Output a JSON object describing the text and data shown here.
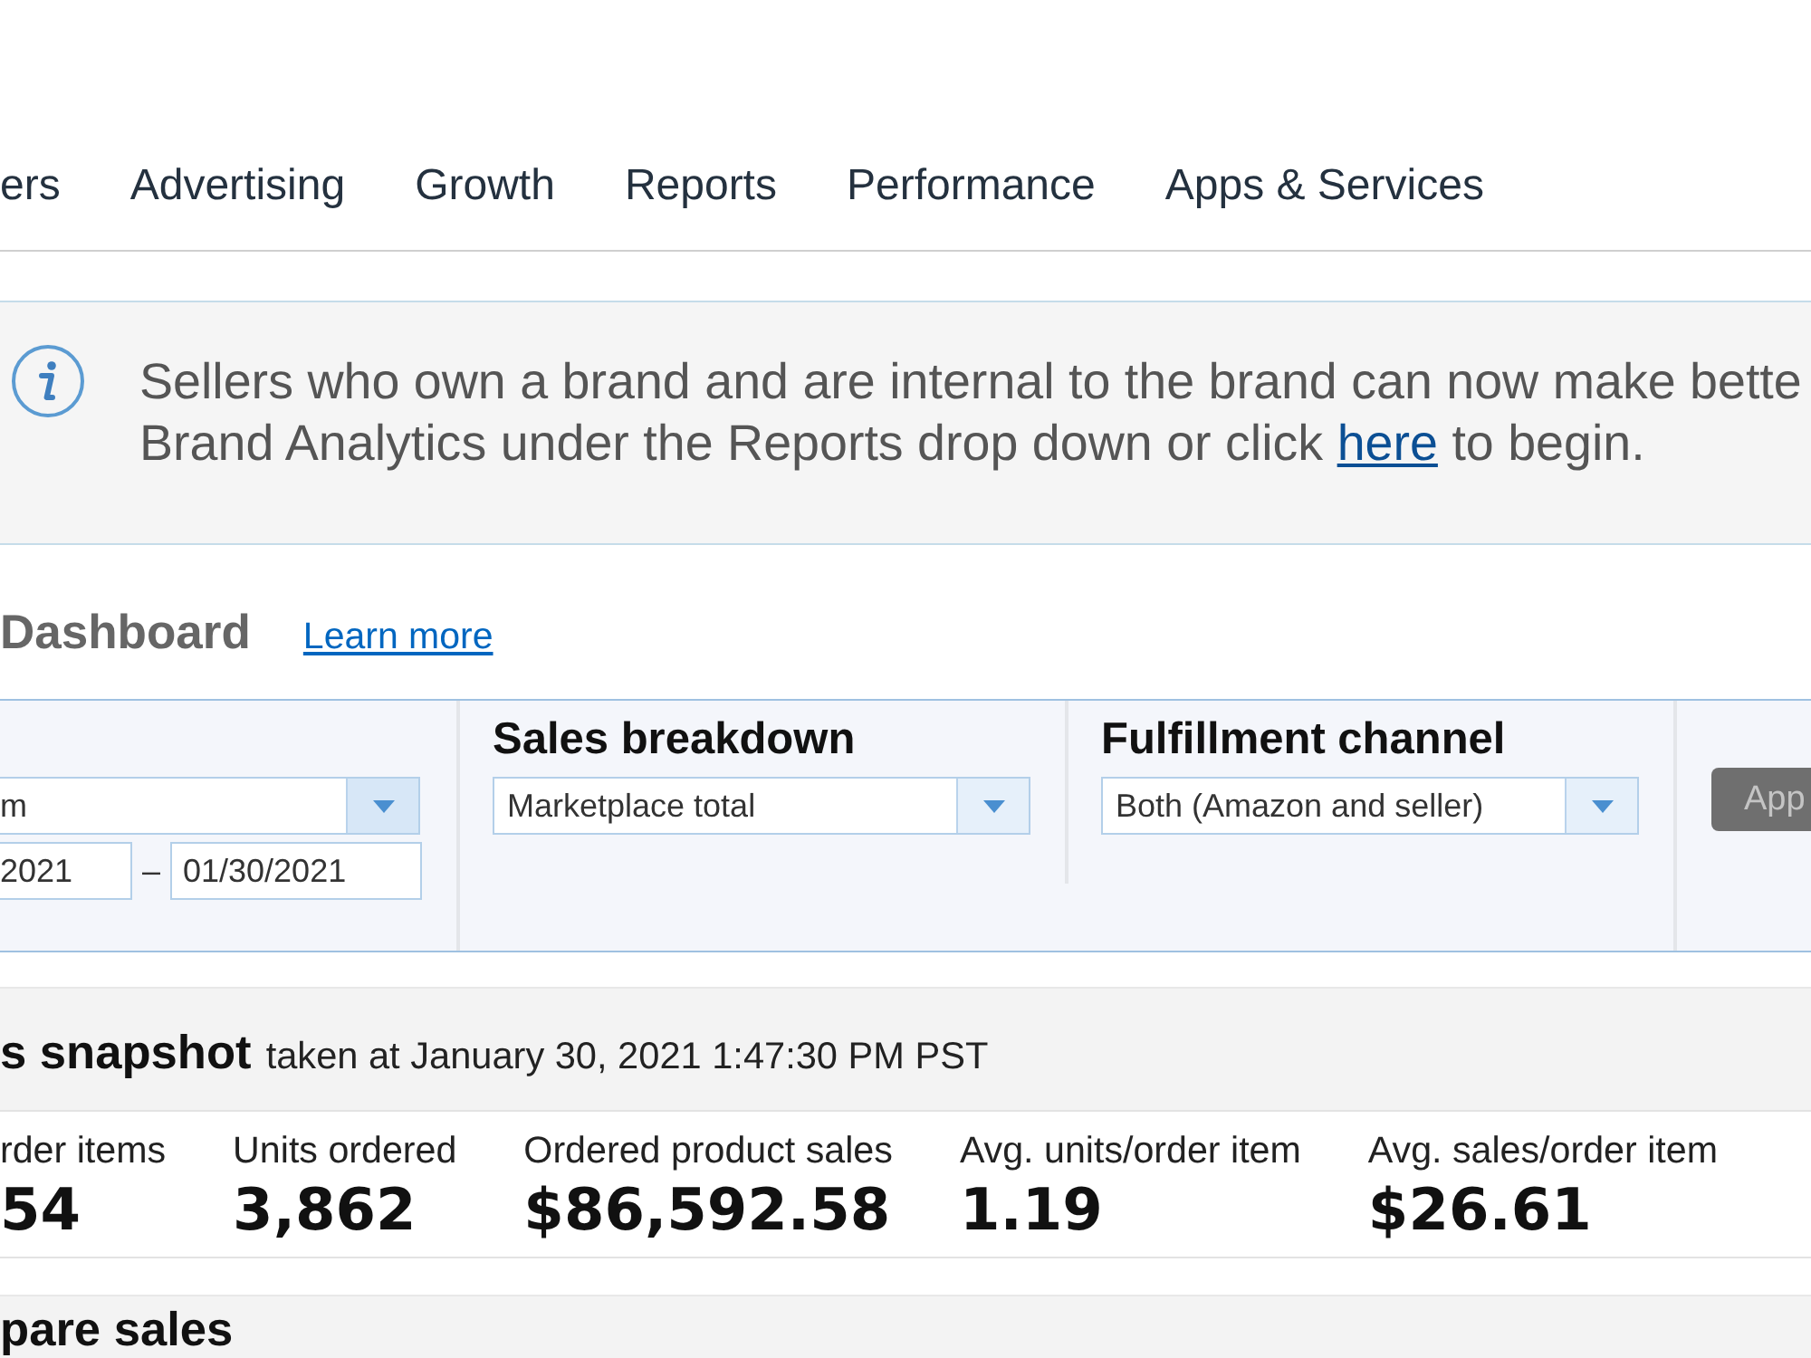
{
  "nav": {
    "items": [
      "ers",
      "Advertising",
      "Growth",
      "Reports",
      "Performance",
      "Apps & Services"
    ]
  },
  "banner": {
    "line_1": "Sellers who own a brand and are internal to the brand can now make bette",
    "line_2_before": "Brand Analytics under the Reports drop down or click",
    "link": "here",
    "line_2_after": "to begin."
  },
  "dashboard": {
    "title": "Dashboard",
    "link": "Learn more"
  },
  "filters": [
    {
      "kind": "date_range",
      "value": "m",
      "start_date": "2021",
      "separator": "–",
      "end_date": "01/30/2021"
    },
    {
      "kind": "select",
      "label": "Sales breakdown",
      "value": "Marketplace total"
    },
    {
      "kind": "select",
      "label": "Fulfillment channel",
      "value": "Both (Amazon and seller)"
    }
  ],
  "apply_button": {
    "label": "App",
    "disabled": true
  },
  "snapshot": {
    "title": "s snapshot",
    "subtitle": "taken at January 30, 2021 1:47:30 PM PST",
    "metrics": [
      {
        "label": "rder items",
        "value": "54"
      },
      {
        "label": "Units ordered",
        "value": "3,862"
      },
      {
        "label": "Ordered product sales",
        "value": "$86,592.58"
      },
      {
        "label": "Avg. units/order item",
        "value": "1.19"
      },
      {
        "label": "Avg. sales/order item",
        "value": "$26.61"
      }
    ]
  },
  "compare": {
    "title": "pare sales"
  }
}
